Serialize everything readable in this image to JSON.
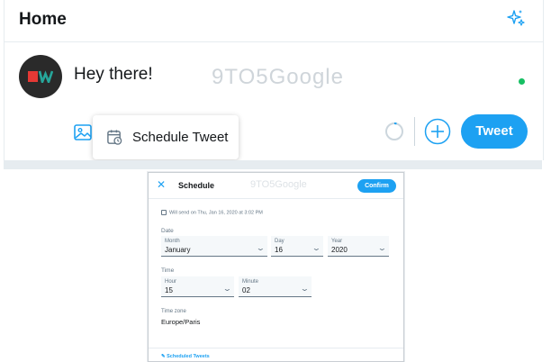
{
  "header": {
    "title": "Home",
    "sparkle_icon": "sparkle-icon"
  },
  "composer": {
    "text": "Hey there!",
    "watermark": "9TO5Google",
    "status_dot_color": "#17bf63"
  },
  "toolbar": {
    "image_icon": "image-icon",
    "schedule_popup_label": "Schedule Tweet",
    "tweet_button_label": "Tweet",
    "accent_color": "#1da1f2"
  },
  "dialog": {
    "close_glyph": "✕",
    "title": "Schedule",
    "watermark": "9TO5Google",
    "confirm_label": "Confirm",
    "send_info": "Will send on Thu, Jan 16, 2020 at 3:02 PM",
    "date_section_label": "Date",
    "month": {
      "label": "Month",
      "value": "January"
    },
    "day": {
      "label": "Day",
      "value": "16"
    },
    "year": {
      "label": "Year",
      "value": "2020"
    },
    "time_section_label": "Time",
    "hour": {
      "label": "Hour",
      "value": "15"
    },
    "minute": {
      "label": "Minute",
      "value": "02"
    },
    "timezone_label": "Time zone",
    "timezone_value": "Europe/Paris",
    "scheduled_tweets_label": "Scheduled Tweets"
  }
}
